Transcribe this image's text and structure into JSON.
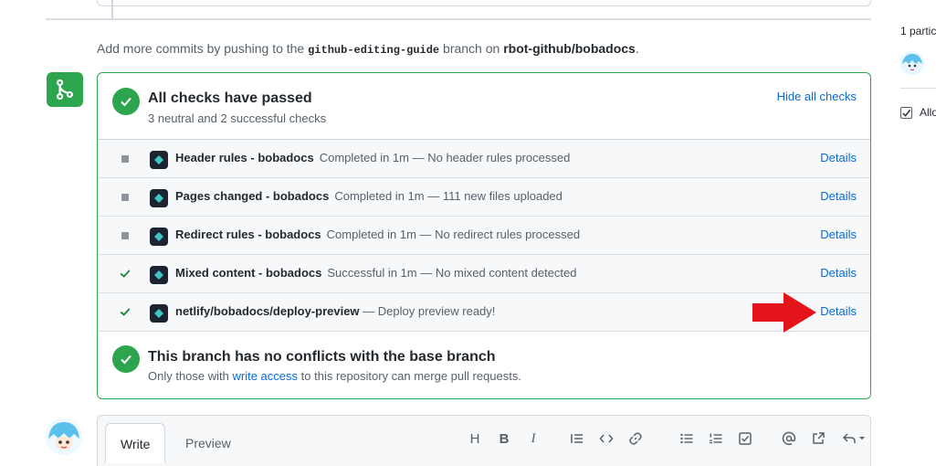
{
  "commit_hint": {
    "prefix": "Add more commits by pushing to the ",
    "branch": "github-editing-guide",
    "middle": " branch on ",
    "repo": "rbot-github/bobadocs",
    "suffix": "."
  },
  "checks": {
    "title": "All checks have passed",
    "subtitle": "3 neutral and 2 successful checks",
    "hide_label": "Hide all checks",
    "items": [
      {
        "status": "neutral",
        "name": "Header rules - bobadocs",
        "desc": "Completed in 1m — No header rules processed",
        "details": "Details"
      },
      {
        "status": "neutral",
        "name": "Pages changed - bobadocs",
        "desc": "Completed in 1m — 111 new files uploaded",
        "details": "Details"
      },
      {
        "status": "neutral",
        "name": "Redirect rules - bobadocs",
        "desc": "Completed in 1m — No redirect rules processed",
        "details": "Details"
      },
      {
        "status": "success",
        "name": "Mixed content - bobadocs",
        "desc": "Successful in 1m — No mixed content detected",
        "details": "Details"
      },
      {
        "status": "success",
        "name": "netlify/bobadocs/deploy-preview",
        "desc": " — Deploy preview ready!",
        "details": "Details"
      }
    ]
  },
  "conflicts": {
    "title": "This branch has no conflicts with the base branch",
    "sub_prefix": "Only those with ",
    "sub_link": "write access",
    "sub_suffix": " to this repository can merge pull requests."
  },
  "sidebar": {
    "participants": "1 partic",
    "allow": "Allo"
  },
  "composer": {
    "tabs": [
      "Write",
      "Preview"
    ],
    "toolbar_icons": [
      "heading-icon",
      "bold-icon",
      "italic-icon",
      "quote-icon",
      "code-icon",
      "link-icon",
      "bulleted-list-icon",
      "numbered-list-icon",
      "task-list-icon",
      "mention-icon",
      "cross-reference-icon",
      "saved-reply-icon"
    ],
    "toolbar_glyphs": [
      "H",
      "B",
      "I"
    ]
  },
  "colors": {
    "success": "#2da44e",
    "link": "#0969da",
    "annotation_arrow": "#e3151a"
  }
}
